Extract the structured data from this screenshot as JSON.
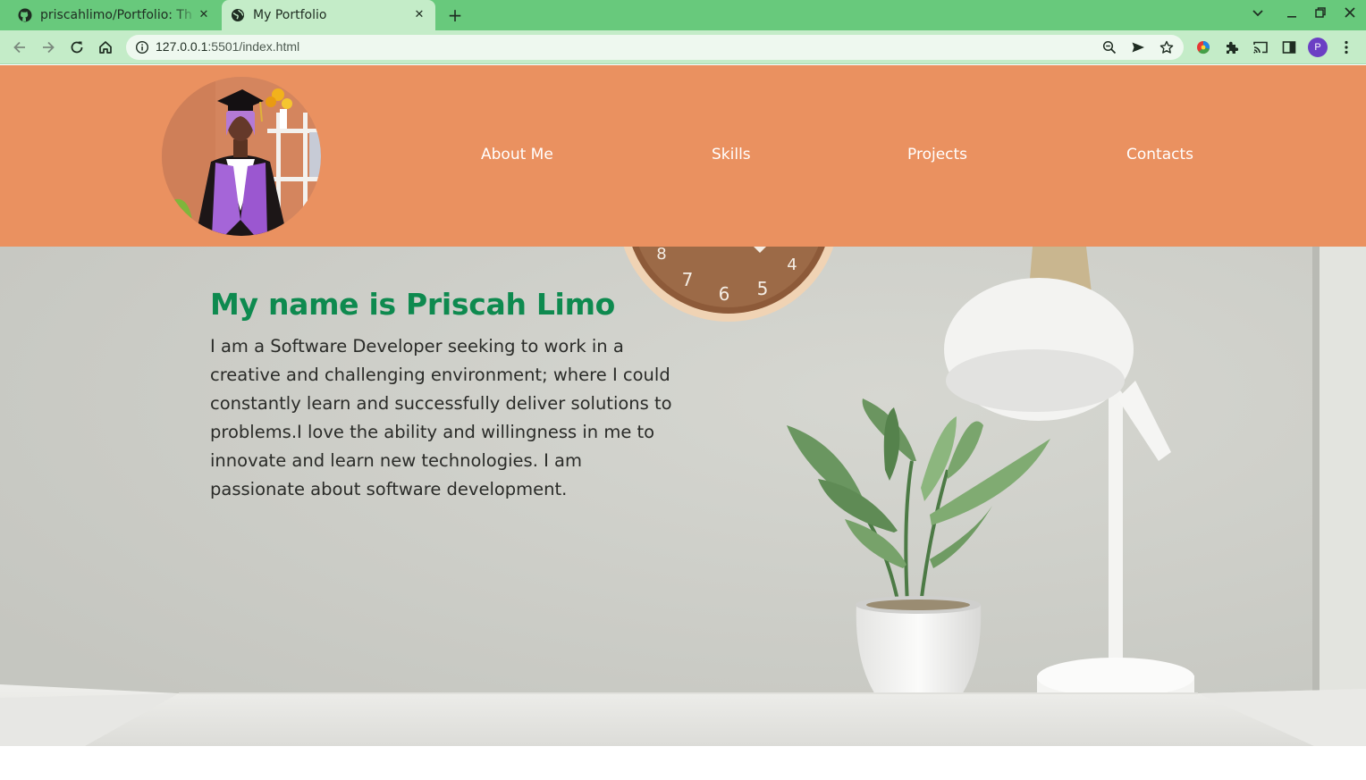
{
  "browser": {
    "tabs": [
      {
        "title": "priscahlimo/Portfolio: Th",
        "icon": "github-icon",
        "active": false
      },
      {
        "title": "My Portfolio",
        "icon": "globe-icon",
        "active": true
      }
    ],
    "new_tab_label": "+",
    "address": {
      "host": "127.0.0.1",
      "path": ":5501/index.html"
    },
    "profile_initial": "P",
    "colors": {
      "frame": "#68c97c",
      "toolbar": "#c4ecc8",
      "profile": "#6b3fc4"
    }
  },
  "site": {
    "header": {
      "background": "#ea9160",
      "avatar_alt": "Profile photo in graduation gown",
      "nav": [
        {
          "label": "About Me"
        },
        {
          "label": "Skills"
        },
        {
          "label": "Projects"
        },
        {
          "label": "Contacts"
        }
      ]
    },
    "hero": {
      "title": "My name is Priscah Limo",
      "title_color": "#0e8a4f",
      "text": "I am a Software Developer seeking to work in a creative and challenging environment; where I could constantly learn and successfully deliver solutions to problems.I love the ability and willingness in me to innovate and learn new technologies. I am passionate about software development.",
      "clock_numbers": [
        "8",
        "7",
        "6",
        "5",
        "4"
      ]
    }
  }
}
